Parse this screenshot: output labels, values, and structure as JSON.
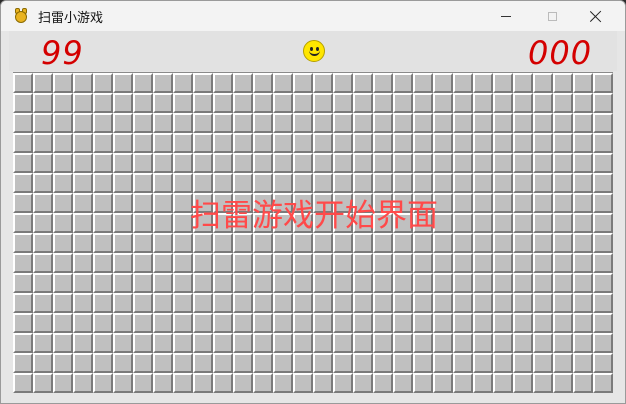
{
  "window": {
    "title": "扫雷小游戏",
    "icon": "pygame-snake-icon"
  },
  "status": {
    "mines_remaining": "99",
    "timer": "000",
    "face": "smiley-icon",
    "counter_color": "#d40000"
  },
  "board": {
    "rows": 16,
    "cols": 30,
    "cell_state": "unrevealed"
  },
  "overlay": {
    "text": "扫雷游戏开始界面",
    "color": "#ff4a4a"
  }
}
